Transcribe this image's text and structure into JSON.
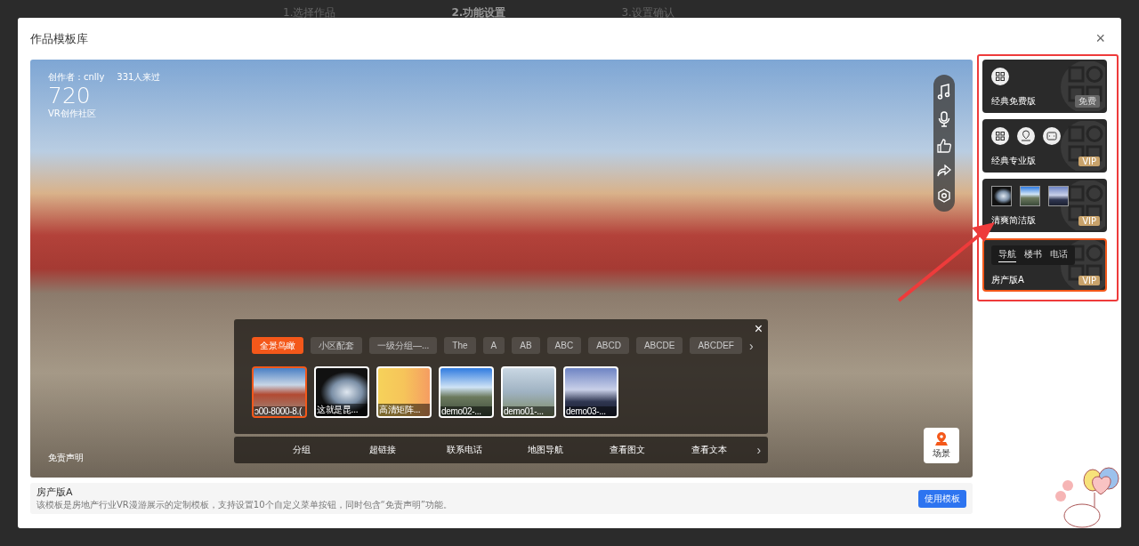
{
  "background_steps": [
    {
      "label": "1.选择作品",
      "selected": false
    },
    {
      "label": "2.功能设置",
      "selected": true
    },
    {
      "label": "3.设置确认",
      "selected": false
    }
  ],
  "modal": {
    "title": "作品模板库",
    "close": "×"
  },
  "preview": {
    "author": "创作者：cnlly",
    "visits": "331人来过",
    "logo": "720",
    "logo_sub": "VR创作社区",
    "group_close": "×",
    "groups": [
      {
        "label": "全景鸟瞰",
        "selected": true
      },
      {
        "label": "小区配套",
        "selected": false
      },
      {
        "label": "一级分组—...",
        "selected": false
      },
      {
        "label": "The",
        "selected": false
      },
      {
        "label": "A",
        "selected": false
      },
      {
        "label": "AB",
        "selected": false
      },
      {
        "label": "ABC",
        "selected": false
      },
      {
        "label": "ABCD",
        "selected": false
      },
      {
        "label": "ABCDE",
        "selected": false
      },
      {
        "label": "ABCDEF",
        "selected": false
      }
    ],
    "group_next": "›",
    "scenes": [
      {
        "label": "ɔ00-8000-8.(",
        "selected": true
      },
      {
        "label": "这就是昆...",
        "selected": false
      },
      {
        "label": "高清矩阵...",
        "selected": false
      },
      {
        "label": "demo02-...",
        "selected": false
      },
      {
        "label": "demo01-...",
        "selected": false
      },
      {
        "label": "demo03-...",
        "selected": false
      }
    ],
    "menu": [
      "分组",
      "超链接",
      "联系电话",
      "地图导航",
      "查看图文",
      "查看文本"
    ],
    "menu_next": "›",
    "disclaimer": "免责声明",
    "scene_button": "场景"
  },
  "templates": [
    {
      "kind": "basic",
      "name": "经典免费版",
      "badge": "免费",
      "vip": false,
      "selected": false
    },
    {
      "kind": "pro",
      "name": "经典专业版",
      "badge": "VIP",
      "vip": true,
      "selected": false
    },
    {
      "kind": "thumbs",
      "name": "清爽简洁版",
      "badge": "VIP",
      "vip": true,
      "selected": false
    },
    {
      "kind": "menu",
      "name": "房产版A",
      "tabs": [
        {
          "label": "导航",
          "selected": true
        },
        {
          "label": "楼书",
          "selected": false
        },
        {
          "label": "电话",
          "selected": false
        }
      ],
      "badge": "VIP",
      "vip": true,
      "selected": true
    }
  ],
  "info": {
    "title": "房产版A",
    "description": "该模板是房地产行业VR漫游展示的定制模板，支持设置10个自定义菜单按钮，同时包含“免责声明”功能。",
    "button": "使用模板"
  }
}
